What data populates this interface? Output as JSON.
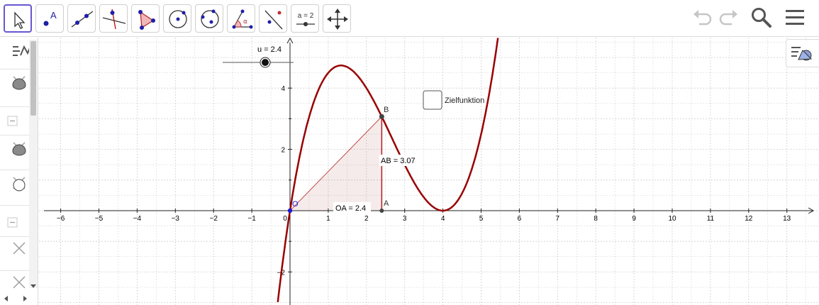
{
  "toolbar": {
    "tools": [
      "move-tool",
      "point-tool",
      "line-tool",
      "perpendicular-line-tool",
      "polygon-tool",
      "circle-center-point-tool",
      "circle-three-points-tool",
      "angle-tool",
      "reflect-tool",
      "slider-tool",
      "move-graphics-view-tool"
    ],
    "slider_tool_label": "a = 2",
    "right_icons": [
      "undo-icon",
      "redo-icon",
      "search-icon",
      "menu-icon"
    ]
  },
  "algebra_view": {
    "header_icon": "algebra-view-icon",
    "items": [
      "delete-icon",
      "collapse-icon",
      "delete-icon",
      "delete-icon",
      "collapse-icon",
      "delete-icon",
      "delete-icon"
    ]
  },
  "graphics": {
    "slider": {
      "label": "u = 2.4",
      "min": 0,
      "max": 4,
      "value": 2.4
    },
    "checkbox": {
      "label": "Zielfunktion",
      "checked": false
    },
    "points": {
      "origin": {
        "label": "O",
        "x": 0,
        "y": 0
      },
      "a": {
        "label": "A",
        "x": 2.4,
        "y": 0
      },
      "b": {
        "label": "B",
        "x": 2.4,
        "y": 3.07
      }
    },
    "segment_labels": {
      "oa": "OA = 2.4",
      "ab": "AB = 3.07"
    },
    "x_ticks": [
      "−6",
      "−5",
      "−4",
      "−3",
      "−2",
      "−1",
      "0",
      "1",
      "2",
      "3",
      "4",
      "5",
      "6",
      "7",
      "8",
      "9",
      "10",
      "11",
      "12",
      "13"
    ],
    "y_ticks": [
      "4",
      "2",
      "−2"
    ],
    "curve_color": "#990000",
    "point_color": "#1b1bd1"
  }
}
